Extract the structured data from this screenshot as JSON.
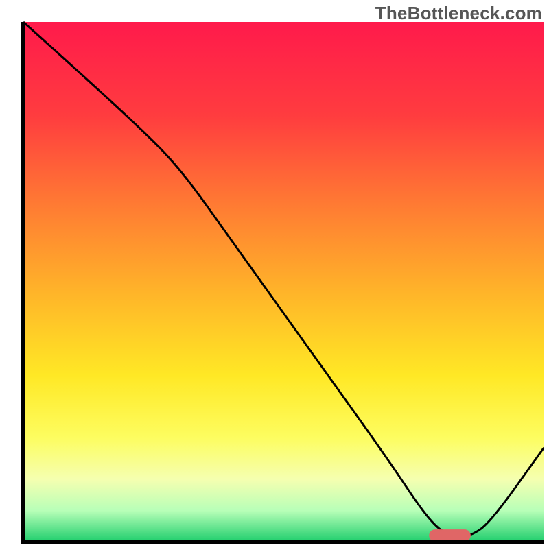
{
  "watermark": "TheBottleneck.com",
  "chart_data": {
    "type": "line",
    "title": "",
    "xlabel": "",
    "ylabel": "",
    "xlim": [
      0,
      100
    ],
    "ylim": [
      0,
      100
    ],
    "grid": false,
    "legend": false,
    "gradient_stops": [
      {
        "offset": 0.0,
        "color": "#ff1a4b"
      },
      {
        "offset": 0.18,
        "color": "#ff3c3f"
      },
      {
        "offset": 0.35,
        "color": "#ff7a33"
      },
      {
        "offset": 0.52,
        "color": "#ffb429"
      },
      {
        "offset": 0.68,
        "color": "#ffe825"
      },
      {
        "offset": 0.8,
        "color": "#fdfd60"
      },
      {
        "offset": 0.88,
        "color": "#f5ffb0"
      },
      {
        "offset": 0.94,
        "color": "#b8ffb8"
      },
      {
        "offset": 1.0,
        "color": "#1fce6d"
      }
    ],
    "series": [
      {
        "name": "bottleneck-curve",
        "color": "#000000",
        "x": [
          0,
          10,
          22,
          30,
          40,
          50,
          60,
          70,
          78,
          82,
          86,
          90,
          100
        ],
        "values": [
          100,
          91,
          80,
          72,
          58,
          44,
          30,
          16,
          4,
          1,
          1,
          4,
          18
        ]
      }
    ],
    "marker": {
      "name": "optimal-range",
      "color": "#e06666",
      "x_start": 78,
      "x_end": 86,
      "y": 1.2,
      "thickness": 2.3
    }
  }
}
